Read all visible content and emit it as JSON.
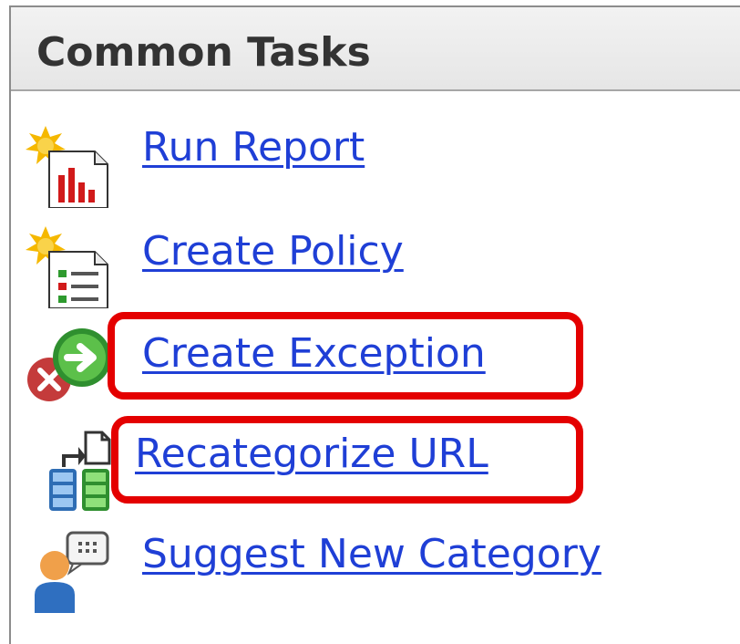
{
  "panel": {
    "title": "Common Tasks"
  },
  "tasks": [
    {
      "label": "Run Report",
      "icon": "run-report-icon",
      "highlighted": false
    },
    {
      "label": "Create Policy",
      "icon": "create-policy-icon",
      "highlighted": false
    },
    {
      "label": "Create Exception",
      "icon": "create-exception-icon",
      "highlighted": true
    },
    {
      "label": "Recategorize URL",
      "icon": "recategorize-url-icon",
      "highlighted": true
    },
    {
      "label": "Suggest New Category",
      "icon": "suggest-category-icon",
      "highlighted": false
    }
  ],
  "colors": {
    "link": "#1f3fd6",
    "highlight": "#e40000",
    "header_text": "#333333"
  }
}
